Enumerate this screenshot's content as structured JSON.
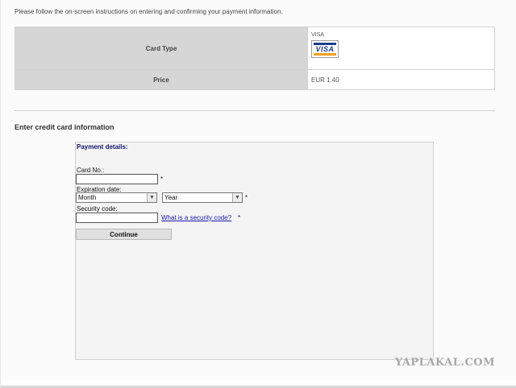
{
  "instructions": "Please follow the on-screen instructions on entering and confirming your payment information.",
  "order_info": {
    "card_type_label": "Card Type",
    "card_type_value": "VISA",
    "card_logo_text": "VISA",
    "price_label": "Price",
    "price_value": "EUR 1.40"
  },
  "section_title": "Enter credit card information",
  "form": {
    "heading": "Payment details:",
    "card_no_label": "Card No.:",
    "card_no_value": "",
    "expiration_label": "Expiration date:",
    "month_selected": "Month",
    "year_selected": "Year",
    "security_label": "Security code:",
    "security_value": "",
    "security_link": "What is a security code?",
    "required_marker": "*",
    "continue_label": "Continue"
  },
  "icons": {
    "card_logo": "visa-logo-icon",
    "select_arrow": "chevron-down-icon"
  },
  "watermark": "YAPLAKAL.COM",
  "colors": {
    "label_cell_bg": "#d6d6d6",
    "form_heading": "#12126e",
    "link": "#1a1aa6",
    "visa_blue": "#1a3e8c",
    "visa_gold": "#f2a01f"
  }
}
